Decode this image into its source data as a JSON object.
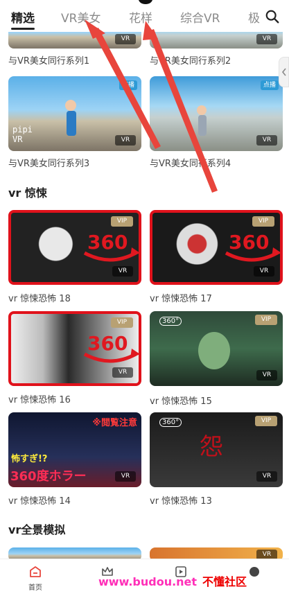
{
  "tabs": [
    {
      "label": "精选"
    },
    {
      "label": "VR美女"
    },
    {
      "label": "花样"
    },
    {
      "label": "综合VR"
    },
    {
      "label": "极"
    }
  ],
  "badges": {
    "vr": "VR",
    "vip": "VIP",
    "live": "点播"
  },
  "row1": [
    {
      "caption": "与VR美女同行系列1"
    },
    {
      "caption": "与VR美女同行系列2"
    }
  ],
  "row2": [
    {
      "caption": "与VR美女同行系列3",
      "overlay": "pipi\nVR"
    },
    {
      "caption": "与VR美女同行系列4"
    }
  ],
  "section_horror": {
    "title": "vr 惊悚"
  },
  "horror": [
    {
      "caption": "vr 惊悚恐怖 18"
    },
    {
      "caption": "vr 惊悚恐怖 17"
    },
    {
      "caption": "vr 惊悚恐怖 16"
    },
    {
      "caption": "vr 惊悚恐怖 15"
    },
    {
      "caption": "vr 惊悚恐怖 14"
    },
    {
      "caption": "vr 惊悚恐怖 13"
    }
  ],
  "thumb_text": {
    "big360": "360",
    "jp_top": "※閲覧注意",
    "jp_mid": "怖すぎ!?",
    "jp_bottom": "360度ホラー",
    "grudge": "怨",
    "mini360": "360°"
  },
  "section_panorama": {
    "title": "vr全景模拟"
  },
  "bottom_nav": {
    "home_label": "首页"
  },
  "watermark": {
    "text": "www.budou.net",
    "brand": "不懂社区"
  },
  "colors": {
    "accent_red": "#e0121b",
    "vip_gold": "#b8a173",
    "arrow_red": "#e8453c",
    "watermark_pink": "#ff2fb8"
  }
}
